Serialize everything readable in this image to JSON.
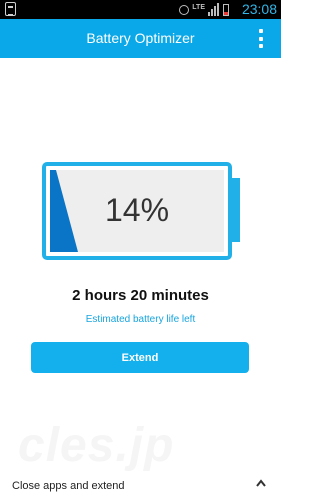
{
  "status_bar": {
    "time": "23:08",
    "lte_label": "LTE",
    "icons": [
      "app-notification-icon",
      "alarm-icon",
      "lte-icon",
      "signal-icon",
      "battery-icon"
    ]
  },
  "app_bar": {
    "title": "Battery Optimizer",
    "menu_icon": "overflow-menu-icon"
  },
  "battery": {
    "percent_label": "14%",
    "level": 0.14,
    "accent_color": "#22b0e8",
    "fill_color": "#0a74c6"
  },
  "estimate": {
    "time_left": "2 hours 20 minutes",
    "label": "Estimated battery life left"
  },
  "actions": {
    "extend_label": "Extend"
  },
  "watermark": {
    "text": "cles.jp"
  },
  "bottom": {
    "label": "Close apps and extend",
    "icon": "chevron-up-icon"
  },
  "colors": {
    "brand": "#0aa8e8",
    "button": "#14b0ee"
  }
}
